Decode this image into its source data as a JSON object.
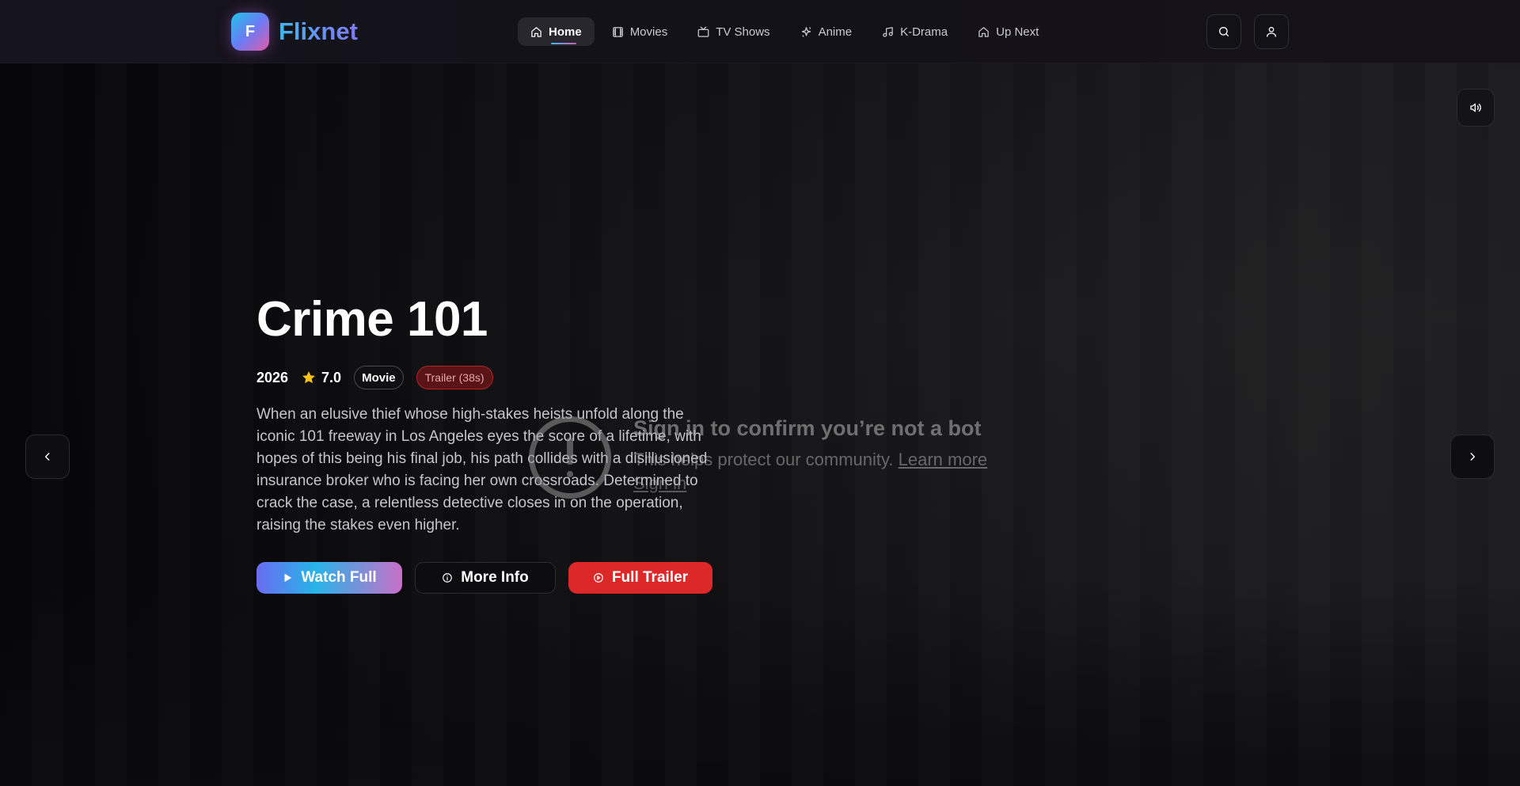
{
  "brand": {
    "logo_letter": "F",
    "name": "Flixnet"
  },
  "nav": {
    "items": [
      {
        "label": "Home",
        "icon": "home-icon",
        "active": true
      },
      {
        "label": "Movies",
        "icon": "film-icon",
        "active": false
      },
      {
        "label": "TV Shows",
        "icon": "tv-icon",
        "active": false
      },
      {
        "label": "Anime",
        "icon": "sparkle-icon",
        "active": false
      },
      {
        "label": "K-Drama",
        "icon": "music-note-icon",
        "active": false
      },
      {
        "label": "Up Next",
        "icon": "home-icon",
        "active": false
      }
    ]
  },
  "header_actions": {
    "search_icon": "search-icon",
    "profile_icon": "user-icon"
  },
  "hero": {
    "title": "Crime 101",
    "year": "2026",
    "rating": "7.0",
    "type_badge": "Movie",
    "trailer_badge": "Trailer (38s)",
    "description": "When an elusive thief whose high-stakes heists unfold along the iconic 101 freeway in Los Angeles eyes the score of a lifetime, with hopes of this being his final job, his path collides with a disillusioned insurance broker who is facing her own crossroads. Determined to crack the case, a relentless detective closes in on the operation, raising the stakes even higher.",
    "buttons": {
      "watch": "Watch Full",
      "info": "More Info",
      "trailer": "Full Trailer"
    }
  },
  "bot_check": {
    "title": "Sign in to confirm you’re not a bot",
    "subtitle": "This helps protect our community.",
    "learn_more": "Learn more",
    "sign_in": "Sign in"
  },
  "colors": {
    "accent_red": "#dc2828",
    "rating_star": "#f6c21c",
    "brand_gradient_start": "#22c3e6",
    "brand_gradient_end": "#e05aa8"
  }
}
